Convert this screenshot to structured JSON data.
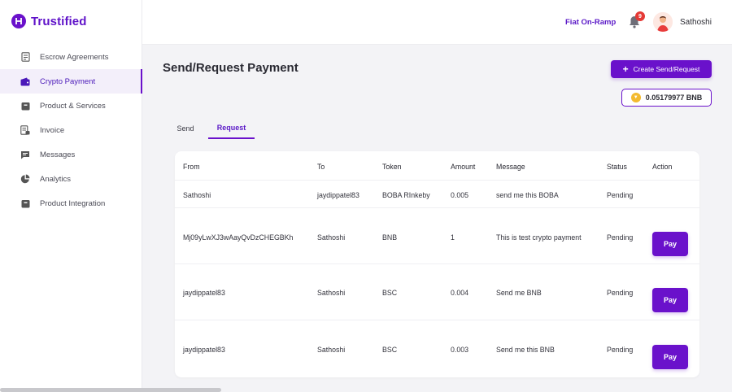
{
  "app": {
    "brand": "Trustified"
  },
  "sidebar": {
    "items": [
      {
        "label": "Escrow Agreements",
        "icon": "document-icon"
      },
      {
        "label": "Crypto Payment",
        "icon": "wallet-icon",
        "active": true
      },
      {
        "label": "Product & Services",
        "icon": "box-icon"
      },
      {
        "label": "Invoice",
        "icon": "invoice-icon"
      },
      {
        "label": "Messages",
        "icon": "message-icon"
      },
      {
        "label": "Analytics",
        "icon": "pie-chart-icon"
      },
      {
        "label": "Product Integration",
        "icon": "box-icon"
      }
    ]
  },
  "header": {
    "fiat_link": "Fiat On-Ramp",
    "notification_count": "9",
    "username": "Sathoshi"
  },
  "main": {
    "title": "Send/Request Payment",
    "create_button": "Create Send/Request",
    "balance": "0.05179977 BNB",
    "tabs": [
      {
        "label": "Send"
      },
      {
        "label": "Request",
        "active": true
      }
    ],
    "table": {
      "headers": [
        "From",
        "To",
        "Token",
        "Amount",
        "Message",
        "Status",
        "Action"
      ],
      "rows": [
        {
          "from": "Sathoshi",
          "to": "jaydippatel83",
          "token": "BOBA RInkeby",
          "amount": "0.005",
          "message": "send me this BOBA",
          "status": "Pending",
          "action": ""
        },
        {
          "from": "Mj09yLwXJ3wAayQvDzCHEGBKh",
          "to": "Sathoshi",
          "token": "BNB",
          "amount": "1",
          "message": "This is test crypto payment",
          "status": "Pending",
          "action": "Pay"
        },
        {
          "from": "jaydippatel83",
          "to": "Sathoshi",
          "token": "BSC",
          "amount": "0.004",
          "message": "Send me BNB",
          "status": "Pending",
          "action": "Pay"
        },
        {
          "from": "jaydippatel83",
          "to": "Sathoshi",
          "token": "BSC",
          "amount": "0.003",
          "message": "Send me this BNB",
          "status": "Pending",
          "action": "Pay"
        }
      ]
    }
  },
  "colors": {
    "accent": "#6a11cb",
    "brand": "#5f12c9",
    "badge": "#e53935",
    "coin": "#f3ba2f"
  }
}
